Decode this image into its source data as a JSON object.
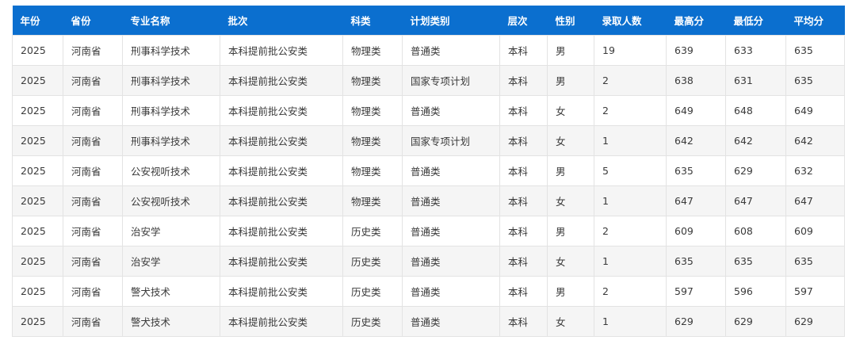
{
  "table": {
    "headers": [
      "年份",
      "省份",
      "专业名称",
      "批次",
      "科类",
      "计划类别",
      "层次",
      "性别",
      "录取人数",
      "最高分",
      "最低分",
      "平均分"
    ],
    "rows": [
      [
        "2025",
        "河南省",
        "刑事科学技术",
        "本科提前批公安类",
        "物理类",
        "普通类",
        "本科",
        "男",
        "19",
        "639",
        "633",
        "635"
      ],
      [
        "2025",
        "河南省",
        "刑事科学技术",
        "本科提前批公安类",
        "物理类",
        "国家专项计划",
        "本科",
        "男",
        "2",
        "638",
        "631",
        "635"
      ],
      [
        "2025",
        "河南省",
        "刑事科学技术",
        "本科提前批公安类",
        "物理类",
        "普通类",
        "本科",
        "女",
        "2",
        "649",
        "648",
        "649"
      ],
      [
        "2025",
        "河南省",
        "刑事科学技术",
        "本科提前批公安类",
        "物理类",
        "国家专项计划",
        "本科",
        "女",
        "1",
        "642",
        "642",
        "642"
      ],
      [
        "2025",
        "河南省",
        "公安视听技术",
        "本科提前批公安类",
        "物理类",
        "普通类",
        "本科",
        "男",
        "5",
        "635",
        "629",
        "632"
      ],
      [
        "2025",
        "河南省",
        "公安视听技术",
        "本科提前批公安类",
        "物理类",
        "普通类",
        "本科",
        "女",
        "1",
        "647",
        "647",
        "647"
      ],
      [
        "2025",
        "河南省",
        "治安学",
        "本科提前批公安类",
        "历史类",
        "普通类",
        "本科",
        "男",
        "2",
        "609",
        "608",
        "609"
      ],
      [
        "2025",
        "河南省",
        "治安学",
        "本科提前批公安类",
        "历史类",
        "普通类",
        "本科",
        "女",
        "1",
        "635",
        "635",
        "635"
      ],
      [
        "2025",
        "河南省",
        "警犬技术",
        "本科提前批公安类",
        "历史类",
        "普通类",
        "本科",
        "男",
        "2",
        "597",
        "596",
        "597"
      ],
      [
        "2025",
        "河南省",
        "警犬技术",
        "本科提前批公安类",
        "历史类",
        "普通类",
        "本科",
        "女",
        "1",
        "629",
        "629",
        "629"
      ]
    ]
  },
  "colors": {
    "header_bg": "#0b6fcf",
    "header_text": "#ffffff",
    "row_alt_bg": "#f5f5f5",
    "border": "#e3e3e3"
  }
}
